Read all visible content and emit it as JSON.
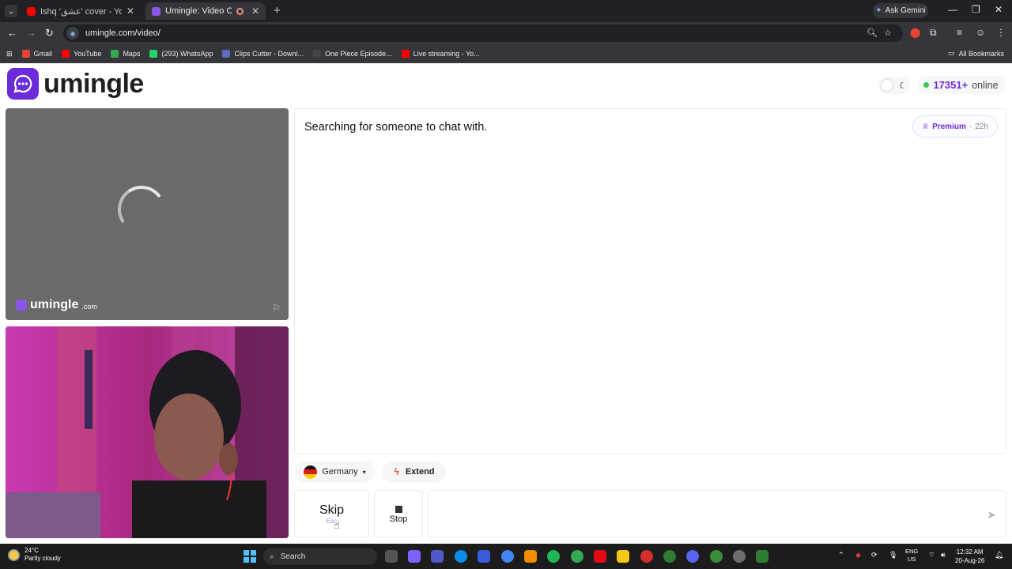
{
  "browser": {
    "tabs": [
      {
        "title": "Ishq 'عشق' cover - YouTube",
        "favicon_color": "#ff0000",
        "active": false
      },
      {
        "title": "Umingle: Video Chat with St",
        "favicon_color": "#8b56e6",
        "active": true
      }
    ],
    "new_tab": "+",
    "ask_gemini": "Ask Gemini",
    "url": "umingle.com/video/",
    "bookmarks": [
      {
        "label": "Gmail",
        "color": "#ea4335"
      },
      {
        "label": "YouTube",
        "color": "#ff0000"
      },
      {
        "label": "Maps",
        "color": "#34a853"
      },
      {
        "label": "(293) WhatsApp",
        "color": "#25d366"
      },
      {
        "label": "Clips Cutter - Downl...",
        "color": "#5c6bc0"
      },
      {
        "label": "One Piece Episode...",
        "color": "#444444"
      },
      {
        "label": "Live streaming - Yo...",
        "color": "#ff0000"
      }
    ],
    "all_bookmarks": "All Bookmarks"
  },
  "site": {
    "logo_text": "umingle",
    "online_count": "17351+",
    "online_label": "online",
    "watermark_text": "umingle",
    "watermark_suffix": ".com",
    "chat_status": "Searching for someone to chat with.",
    "premium_label": "Premium",
    "premium_sep": "·",
    "premium_time": "22h",
    "country": "Germany",
    "extend_label": "Extend",
    "skip_label": "Skip",
    "skip_key": "Esc",
    "stop_label": "Stop",
    "message_placeholder": ""
  },
  "taskbar": {
    "temperature": "24°C",
    "weather": "Partly cloudy",
    "search_placeholder": "Search",
    "lang_top": "ENG",
    "lang_bottom": "US",
    "time": "12:32 AM",
    "date": "20-Aug-26"
  },
  "colors": {
    "brand": "#6b2bd9",
    "online_dot": "#34c759",
    "extend_bolt": "#f4511e"
  }
}
